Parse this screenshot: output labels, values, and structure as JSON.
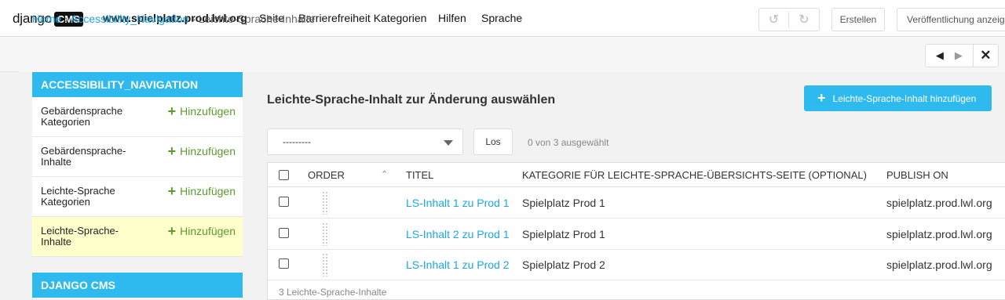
{
  "toolbar": {
    "logo_word": "django",
    "logo_box": "CMS",
    "site": "www.spielplatz.prod.lwl.org",
    "menu": [
      "Seite",
      "Barrierefreiheit Kategorien",
      "Hilfen",
      "Sprache"
    ],
    "undo_icon": "↺",
    "redo_icon": "↻",
    "create_label": "Erstellen",
    "publish_label": "Veröffentlichung anzeigen"
  },
  "breadcrumb": {
    "home": "Home",
    "separator": "›",
    "section": "Accessibility_Navigation",
    "current": "Leichte-Sprache-Inhalte"
  },
  "sidenav": {
    "prev_icon": "◀",
    "next_icon": "▶",
    "close_icon": "✕"
  },
  "modules": [
    {
      "header": "ACCESSIBILITY_NAVIGATION",
      "items": [
        {
          "label": "Gebärdensprache Kategorien",
          "add": "Hinzufügen",
          "active": false
        },
        {
          "label": "Gebärdensprache-Inhalte",
          "add": "Hinzufügen",
          "active": false
        },
        {
          "label": "Leichte-Sprache Kategorien",
          "add": "Hinzufügen",
          "active": false
        },
        {
          "label": "Leichte-Sprache-Inhalte",
          "add": "Hinzufügen",
          "active": true
        }
      ]
    },
    {
      "header": "DJANGO CMS",
      "items": []
    }
  ],
  "content": {
    "title": "Leichte-Sprache-Inhalt zur Änderung auswählen",
    "add_button": "Leichte-Sprache-Inhalt hinzufügen",
    "action_select_value": "---------",
    "go_button": "Los",
    "counter": "0 von 3 ausgewählt",
    "columns": [
      "ORDER",
      "TITEL",
      "KATEGORIE FÜR LEICHTE-SPRACHE-ÜBERSICHTS-SEITE (OPTIONAL)",
      "PUBLISH ON"
    ],
    "sort_icon": "⌃",
    "rows": [
      {
        "title": "LS-Inhalt 1 zu Prod 1",
        "category": "Spielplatz Prod 1",
        "publish_on": "spielplatz.prod.lwl.org"
      },
      {
        "title": "LS-Inhalt 2 zu Prod 1",
        "category": "Spielplatz Prod 1",
        "publish_on": "spielplatz.prod.lwl.org"
      },
      {
        "title": "LS-Inhalt 1 zu Prod 2",
        "category": "Spielplatz Prod 2",
        "publish_on": "spielplatz.prod.lwl.org"
      }
    ],
    "footer": "3 Leichte-Sprache-Inhalte"
  },
  "colors": {
    "accent": "#2ebaee",
    "link": "#1aa7e2",
    "add_green": "#5b9b2d",
    "active_row": "#ffffcc"
  }
}
